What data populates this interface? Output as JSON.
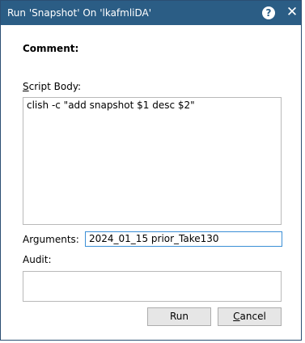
{
  "dialog": {
    "title": "Run 'Snapshot' On 'lkafmliDA'",
    "help_icon": "question-icon",
    "close_icon": "close-icon",
    "titlebar_color": "#2b5d85"
  },
  "form": {
    "comment_label": "Comment:",
    "script_body_label": "Script Body:",
    "script_body_value": "clish -c \"add snapshot $1 desc $2\"",
    "arguments_label": "Arguments:",
    "arguments_value": "2024_01_15 prior_Take130",
    "audit_label": "Audit:",
    "audit_value": ""
  },
  "buttons": {
    "run_label": "Run",
    "cancel_label": "Cancel"
  }
}
